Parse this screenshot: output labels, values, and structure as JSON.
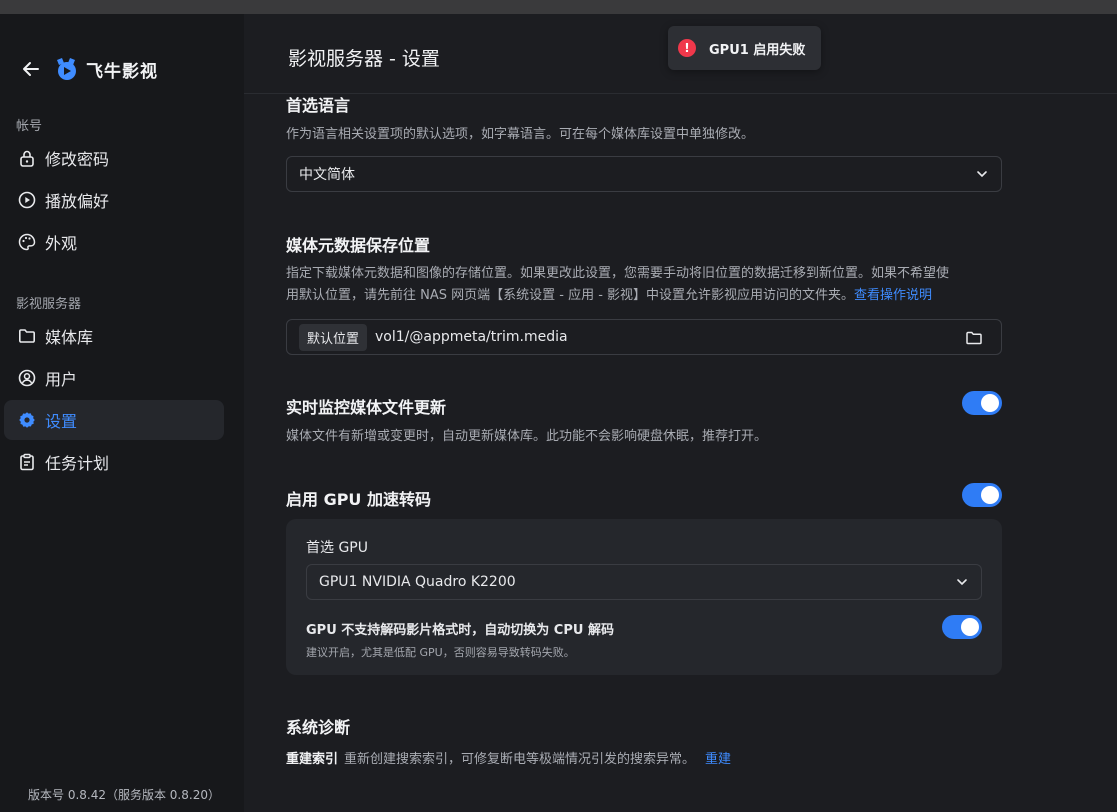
{
  "app": {
    "name": "飞牛影视",
    "version_text": "版本号 0.8.42（服务版本 0.8.20）"
  },
  "sidebar": {
    "account_label": "帐号",
    "account_items": [
      {
        "label": "修改密码",
        "icon": "lock-icon"
      },
      {
        "label": "播放偏好",
        "icon": "play-circle-icon"
      },
      {
        "label": "外观",
        "icon": "palette-icon"
      }
    ],
    "server_label": "影视服务器",
    "server_items": [
      {
        "label": "媒体库",
        "icon": "folder-icon"
      },
      {
        "label": "用户",
        "icon": "user-circle-icon"
      },
      {
        "label": "设置",
        "icon": "gear-icon",
        "active": true
      },
      {
        "label": "任务计划",
        "icon": "clipboard-icon"
      }
    ]
  },
  "header": {
    "title": "影视服务器 - 设置"
  },
  "toast": {
    "message": "GPU1 启用失败",
    "icon": "error-icon",
    "color": "#f0384b"
  },
  "language": {
    "title": "首选语言",
    "description": "作为语言相关设置项的默认选项，如字幕语言。可在每个媒体库设置中单独修改。",
    "value": "中文简体"
  },
  "metadata": {
    "title": "媒体元数据保存位置",
    "description_line1": "指定下载媒体元数据和图像的存储位置。如果更改此设置，您需要手动将旧位置的数据迁移到新位置。如果不希望使",
    "description_line2": "用默认位置，请先前往 NAS 网页端【系统设置 - 应用 - 影视】中设置允许影视应用访问的文件夹。",
    "help_link": "查看操作说明",
    "path_tag": "默认位置",
    "path_value": "vol1/@appmeta/trim.media"
  },
  "monitor": {
    "title": "实时监控媒体文件更新",
    "description": "媒体文件有新增或变更时，自动更新媒体库。此功能不会影响硬盘休眠，推荐打开。",
    "enabled": true
  },
  "gpu": {
    "title": "启用 GPU 加速转码",
    "enabled": true,
    "preferred_label": "首选 GPU",
    "preferred_value": "GPU1 NVIDIA Quadro K2200",
    "fallback_title": "GPU 不支持解码影片格式时，自动切换为 CPU 解码",
    "fallback_desc": "建议开启，尤其是低配 GPU，否则容易导致转码失败。",
    "fallback_enabled": true
  },
  "diagnostics": {
    "title": "系统诊断",
    "rebuild_label": "重建索引",
    "rebuild_desc": "重新创建搜索索引，可修复断电等极端情况引发的搜索异常。",
    "rebuild_link": "重建"
  },
  "colors": {
    "accent": "#3f8cff",
    "toggle_on": "#2f7cf5",
    "background": "#1c1d21",
    "sidebar": "#17181b"
  }
}
